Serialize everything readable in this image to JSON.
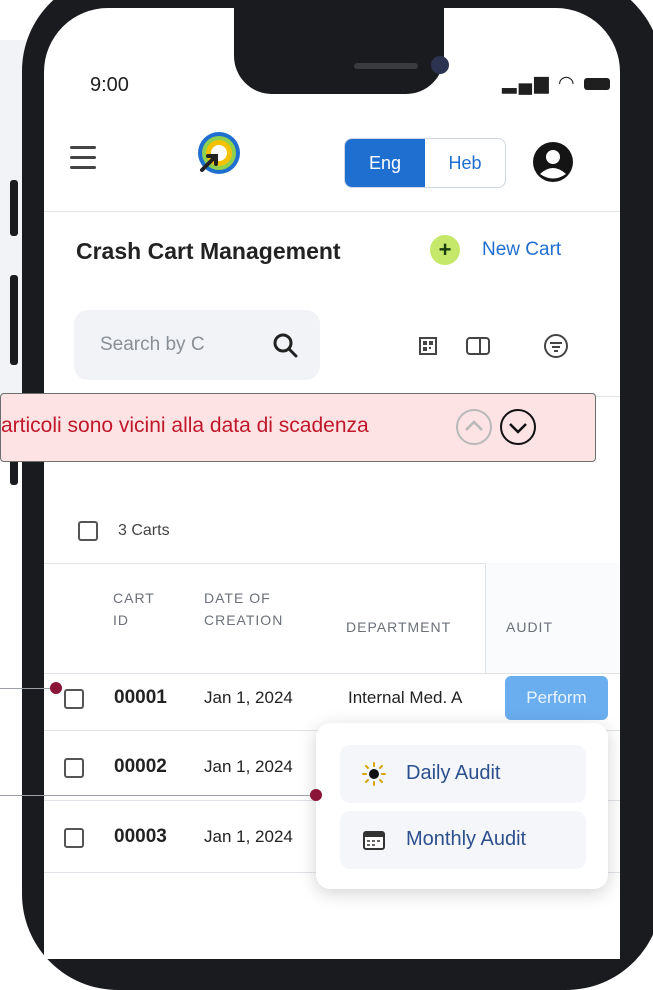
{
  "status_bar": {
    "time": "9:00",
    "icons": [
      "signal-icon",
      "wifi-icon",
      "battery-icon"
    ]
  },
  "header": {
    "menu_icon": "hamburger-icon",
    "logo_icon": "app-logo",
    "language": {
      "options": [
        "Eng",
        "Heb"
      ],
      "selected": "Eng"
    },
    "account_icon": "user-icon"
  },
  "page": {
    "title": "Crash Cart Management",
    "new_cart_label": "New Cart"
  },
  "search": {
    "placeholder": "Search by C"
  },
  "toolbar": {
    "icons": [
      "qr-code-icon",
      "card-icon",
      "filter-icon"
    ]
  },
  "alert": {
    "text": "articoli sono vicini alla data di scadenza",
    "color": "#c0182a"
  },
  "list": {
    "count_label": "3 Carts",
    "headers": {
      "cart_id": "CART\nID",
      "date": "DATE OF\nCREATION",
      "department": "DEPARTMENT",
      "audit": "AUDIT"
    },
    "rows": [
      {
        "id": "00001",
        "date": "Jan 1, 2024",
        "department": "Internal Med. A",
        "audit": "Perform"
      },
      {
        "id": "00002",
        "date": "Jan 1, 2024"
      },
      {
        "id": "00003",
        "date": "Jan 1, 2024"
      }
    ]
  },
  "audit_menu": {
    "items": [
      {
        "label": "Daily Audit",
        "icon": "sun-icon"
      },
      {
        "label": "Monthly Audit",
        "icon": "calendar-icon"
      }
    ]
  },
  "colors": {
    "accent": "#1f6fd1",
    "marker": "#8a1538",
    "alert_bg": "#fde3e3",
    "new_cart_plus": "#c6e86a"
  }
}
